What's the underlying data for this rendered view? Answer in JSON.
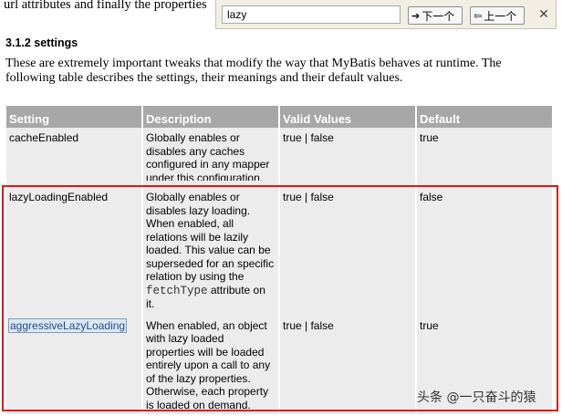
{
  "intro_fragment": "url attributes and finally the properties",
  "findbar": {
    "query": "lazy",
    "next_label": "下一个",
    "prev_label": "上一个",
    "close_glyph": "✕"
  },
  "section": {
    "heading": "3.1.2 settings",
    "paragraph": "These are extremely important tweaks that modify the way that MyBatis behaves at runtime. The following table describes the settings, their meanings and their default values."
  },
  "table": {
    "headers": [
      "Setting",
      "Description",
      "Valid Values",
      "Default"
    ],
    "rows": [
      {
        "setting": "cacheEnabled",
        "description": "Globally enables or disables any caches configured in any mapper under this configuration.",
        "valid": "true | false",
        "default": "true"
      },
      {
        "setting": "lazyLoadingEnabled",
        "description_pre": "Globally enables or disables lazy loading. When enabled, all relations will be lazily loaded. This value can be superseded for an specific relation by using the ",
        "description_code": "fetchType",
        "description_post": " attribute on it.",
        "valid": "true | false",
        "default": "false"
      },
      {
        "setting": "aggressiveLazyLoading",
        "description": "When enabled, an object with lazy loaded properties will be loaded entirely upon a call to any of the lazy properties. Otherwise, each property is loaded on demand.",
        "valid": "true | false",
        "default": "true"
      }
    ]
  },
  "watermark": "头条 @一只奋斗的猿",
  "colors": {
    "header_bg": "#a7a7a7",
    "cell_bg": "#ececec",
    "highlight_box": "#e0141a",
    "findbar_bg": "#f2eee4"
  },
  "icons": {
    "next": "arrow-right-icon",
    "prev": "arrow-left-icon",
    "close": "close-icon"
  }
}
